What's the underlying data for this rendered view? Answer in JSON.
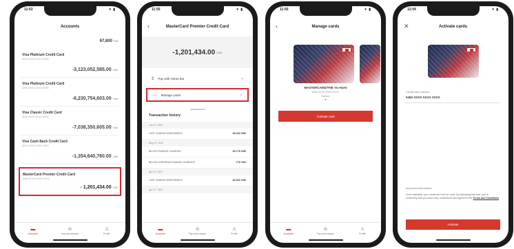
{
  "status_time_1": "11:53",
  "status_time_2": "11:55",
  "status_time_3": "11:55",
  "status_time_4": "12:04",
  "status_icons": "▾ ▮",
  "colors": {
    "accent": "#d3392f",
    "highlight": "#d7262e"
  },
  "tabs": [
    {
      "icon": "briefcase-icon",
      "label": "Accounts"
    },
    {
      "icon": "gear-icon",
      "label": "Pay and transfer"
    },
    {
      "icon": "person-icon",
      "label": "Profile"
    }
  ],
  "phone1": {
    "title": "Accounts",
    "total": "67,800",
    "total_currency": "VND",
    "accounts": [
      {
        "name": "Visa Platinum Credit Card",
        "number": "4376 XXXX XXXX XXXX",
        "balance": "-3,123,052,585.00",
        "currency": "VND"
      },
      {
        "name": "Visa Platinum Credit Card",
        "number": "4376 XXXX XXXX XXXX",
        "balance": "-6,230,754,603.00",
        "currency": "VND"
      },
      {
        "name": "Visa Classic Credit Card",
        "number": "4242 XXXX XXXX XXXX",
        "balance": "-7,038,350,605.00",
        "currency": "VND"
      },
      {
        "name": "Visa Cash Back Credit Card",
        "number": "4242 XXXX XXXX XXXX",
        "balance": "-1,354,640,760.00",
        "currency": "VND"
      },
      {
        "name": "MasterCard Premier Credit Card",
        "number": "5460 XXXX XXXX XXXX",
        "balance": "- 1,201,434.00",
        "currency": "VND"
      }
    ]
  },
  "phone2": {
    "title": "MasterCard Premier Credit Card",
    "subtitle": "5460 XXXX XXXX XXXX",
    "balance": "-1,201,434.00",
    "currency": "VND",
    "actions": [
      {
        "label": "Pay with Home bar",
        "icon": "dollar-icon"
      },
      {
        "label": "Manage cards",
        "icon": "card-icon"
      }
    ],
    "history_title": "Transaction history",
    "transactions": [
      {
        "date": "Jun 07, 2022",
        "desc": "LATE CHARGE ASSESSMENT",
        "amount": "-80,000 VND"
      },
      {
        "date": "May 07, 2022",
        "desc": "BILLED FINANCE CHARGES",
        "amount": "-59,778 VND"
      },
      {
        "date": "",
        "desc": "BILLED OVERSEAS FINANCE CHARGES",
        "amount": "-778 VND"
      },
      {
        "date": "Apr 07, 2022",
        "desc": "LATE CHARGE ASSESSMENT",
        "amount": "-80,000 VND"
      },
      {
        "date": "Apr 07, 2022",
        "desc": "",
        "amount": ""
      }
    ]
  },
  "phone3": {
    "title": "Manage cards",
    "card_holder": "MASTERCARD/THE YU HUAI",
    "card_number": "5460 XXXX XXXX XXXX",
    "card_status": "Inactive",
    "button": "Activate card"
  },
  "phone4": {
    "title": "Activate cards",
    "field_label": "Credit card number",
    "field_value": "5460 XXXX XXXX XXXX",
    "section_title": "Important information",
    "terms_text": "Once activated, your credit card can be used. By activating this card, you're confirming that you have read, understood and agreed to the",
    "terms_link": "Terms and Conditions",
    "button": "Activate"
  }
}
